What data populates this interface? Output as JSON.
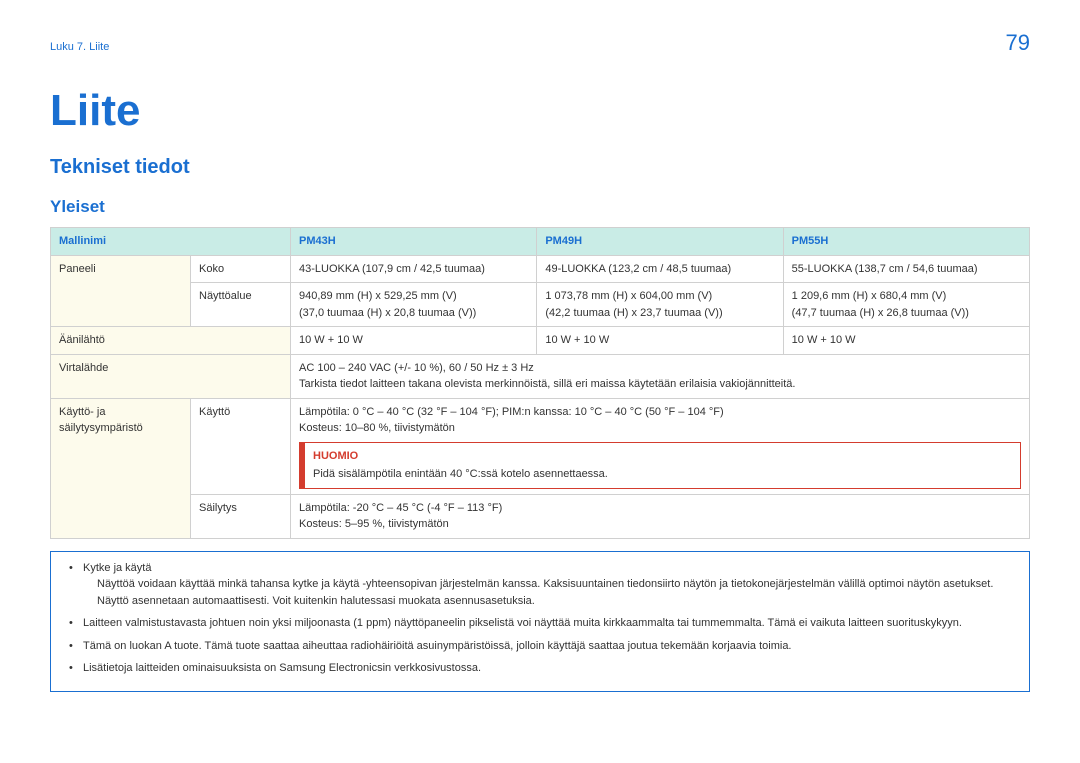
{
  "header": {
    "breadcrumb": "Luku 7. Liite",
    "page_number": "79"
  },
  "title": "Liite",
  "section": "Tekniset tiedot",
  "subsection": "Yleiset",
  "spec_table": {
    "headers": {
      "model_label": "Mallinimi",
      "m1": "PM43H",
      "m2": "PM49H",
      "m3": "PM55H"
    },
    "rows": {
      "panel_label": "Paneeli",
      "panel_size_label": "Koko",
      "panel_size": {
        "m1": "43-LUOKKA (107,9 cm / 42,5 tuumaa)",
        "m2": "49-LUOKKA (123,2 cm / 48,5 tuumaa)",
        "m3": "55-LUOKKA (138,7 cm / 54,6 tuumaa)"
      },
      "display_area_label": "Näyttöalue",
      "display_area": {
        "m1": "940,89 mm (H) x 529,25 mm (V)\n(37,0 tuumaa (H) x 20,8 tuumaa (V))",
        "m2": "1 073,78 mm (H) x 604,00 mm (V)\n(42,2 tuumaa (H) x 23,7 tuumaa (V))",
        "m3": "1 209,6 mm (H) x 680,4 mm (V)\n(47,7 tuumaa (H) x 26,8 tuumaa (V))"
      },
      "audio_label": "Äänilähtö",
      "audio": {
        "m1": "10 W + 10 W",
        "m2": "10 W + 10 W",
        "m3": "10 W + 10 W"
      },
      "power_label": "Virtalähde",
      "power_line1": "AC 100 – 240 VAC (+/- 10 %), 60 / 50 Hz ± 3 Hz",
      "power_line2": "Tarkista tiedot laitteen takana olevista merkinnöistä, sillä eri maissa käytetään erilaisia vakiojännitteitä.",
      "env_label": "Käyttö- ja säilytysympäristö",
      "operating_label": "Käyttö",
      "operating_line1": "Lämpötila: 0 °C – 40 °C (32 °F – 104 °F); PIM:n kanssa: 10 °C – 40 °C (50 °F – 104 °F)",
      "operating_line2": "Kosteus: 10–80 %, tiivistymätön",
      "caution_label": "HUOMIO",
      "caution_text": "Pidä sisälämpötila enintään 40 °C:ssä kotelo asennettaessa.",
      "storage_label": "Säilytys",
      "storage_line1": "Lämpötila: -20 °C – 45 °C (-4 °F – 113 °F)",
      "storage_line2": "Kosteus: 5–95 %, tiivistymätön"
    }
  },
  "notes": {
    "n1_title": "Kytke ja käytä",
    "n1_body": "Näyttöä voidaan käyttää minkä tahansa kytke ja käytä -yhteensopivan järjestelmän kanssa. Kaksisuuntainen tiedonsiirto näytön ja tietokonejärjestelmän välillä optimoi näytön asetukset. Näyttö asennetaan automaattisesti. Voit kuitenkin halutessasi muokata asennusasetuksia.",
    "n2": "Laitteen valmistustavasta johtuen noin yksi miljoonasta (1 ppm) näyttöpaneelin pikselistä voi näyttää muita kirkkaammalta tai tummemmalta. Tämä ei vaikuta laitteen suorituskykyyn.",
    "n3": "Tämä on luokan A tuote. Tämä tuote saattaa aiheuttaa radiohäiriöitä asuinympäristöissä, jolloin käyttäjä saattaa joutua tekemään korjaavia toimia.",
    "n4": "Lisätietoja laitteiden ominaisuuksista on Samsung Electronicsin verkkosivustossa."
  }
}
